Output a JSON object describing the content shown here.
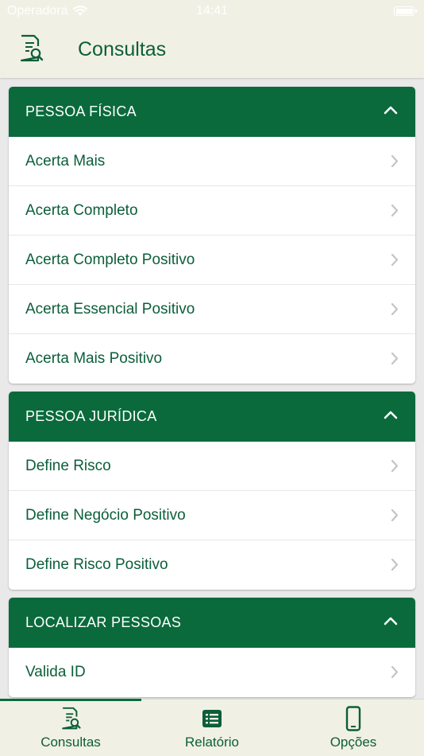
{
  "status_bar": {
    "carrier": "Operadora",
    "time": "14:41"
  },
  "navbar": {
    "title": "Consultas",
    "icon": "search-document-icon"
  },
  "sections": [
    {
      "title": "PESSOA FÍSICA",
      "expanded": true,
      "items": [
        "Acerta Mais",
        "Acerta Completo",
        "Acerta Completo Positivo",
        "Acerta Essencial Positivo",
        "Acerta Mais Positivo"
      ]
    },
    {
      "title": "PESSOA JURÍDICA",
      "expanded": true,
      "items": [
        "Define Risco",
        "Define Negócio Positivo",
        "Define Risco Positivo"
      ]
    },
    {
      "title": "LOCALIZAR PESSOAS",
      "expanded": true,
      "items": [
        "Valida ID"
      ]
    }
  ],
  "tabbar": {
    "active": "Consultas",
    "tabs": [
      {
        "label": "Consultas",
        "icon": "search-document-icon"
      },
      {
        "label": "Relatório",
        "icon": "list-icon"
      },
      {
        "label": "Opções",
        "icon": "phone-icon"
      }
    ]
  },
  "colors": {
    "primary": "#0a6a3c",
    "text": "#0b5e3a",
    "bar_background": "#f1f0e4",
    "page_background": "#e9e9e9"
  }
}
